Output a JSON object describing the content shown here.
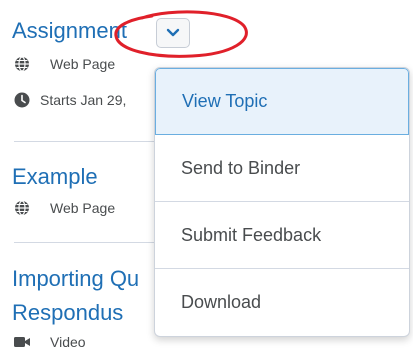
{
  "content_list": {
    "items": [
      {
        "title": "Assignment",
        "meta": [
          {
            "icon": "globe-icon",
            "text": "Web Page"
          },
          {
            "icon": "clock-icon",
            "text": "Starts Jan 29,"
          }
        ]
      },
      {
        "title": "Example",
        "meta": [
          {
            "icon": "globe-icon",
            "text": "Web Page"
          }
        ]
      },
      {
        "title_line1": "Importing Qu",
        "title_line2": "Respondus",
        "meta": [
          {
            "icon": "video-icon",
            "text": "Video"
          }
        ]
      }
    ]
  },
  "dropdown": {
    "toggle_icon": "chevron-down-icon",
    "items": [
      {
        "label": "View Topic",
        "active": true
      },
      {
        "label": "Send to Binder"
      },
      {
        "label": "Submit Feedback"
      },
      {
        "label": "Download"
      }
    ]
  },
  "colors": {
    "link": "#1f6fb5",
    "text": "#494c4e",
    "annotation": "#e0202a",
    "active_bg": "#e8f2fb"
  }
}
